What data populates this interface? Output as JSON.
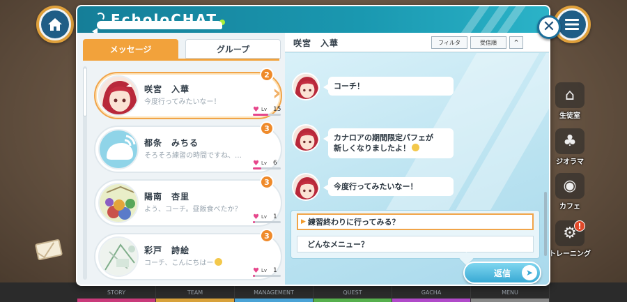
{
  "app": {
    "title": "EcholoCHAT"
  },
  "tabs": [
    {
      "label": "メッセージ",
      "active": true
    },
    {
      "label": "グループ",
      "active": false
    }
  ],
  "contacts": [
    {
      "name": "咲宮　入華",
      "preview": "今度行ってみたいなー！",
      "unread": "2",
      "level": "15",
      "selected": true
    },
    {
      "name": "都条　みちる",
      "preview": "そろそろ練習の時間ですね、…",
      "unread": "3",
      "level": "6",
      "selected": false
    },
    {
      "name": "陽南　杏里",
      "preview": "よう、コーチ。昼飯食べたか？",
      "unread": "3",
      "level": "1",
      "selected": false
    },
    {
      "name": "彩戸　詩絵",
      "preview": "コーチ、こんにちはー",
      "unread": "3",
      "level": "1",
      "selected": false
    }
  ],
  "level_label": "Lv",
  "chat": {
    "partner_name": "咲宮　入華",
    "filter_label": "フィルタ",
    "sort_label": "受信順",
    "messages": [
      {
        "text": "コーチ！"
      },
      {
        "text_line1": "カナロアの期間限定パフェが",
        "text_line2": "新しくなりましたよ！"
      },
      {
        "text": "今度行ってみたいなー！"
      }
    ],
    "choices": [
      {
        "text": "練習終わりに行ってみる？",
        "selected": true
      },
      {
        "text": "どんなメニュー？",
        "selected": false
      }
    ],
    "reply_label": "返信"
  },
  "side_menu": [
    {
      "label": "生徒室",
      "icon": "hanger-icon"
    },
    {
      "label": "ジオラマ",
      "icon": "palm-tree-icon"
    },
    {
      "label": "カフェ",
      "icon": "plate-icon"
    },
    {
      "label": "トレーニング",
      "icon": "bike-icon",
      "badge": "!"
    }
  ],
  "bottom_nav": [
    {
      "label": "STORY",
      "color": "#c93a7a"
    },
    {
      "label": "TEAM",
      "color": "#d8a13a"
    },
    {
      "label": "MANAGEMENT",
      "color": "#4aa3d6"
    },
    {
      "label": "QUEST",
      "color": "#56b04d"
    },
    {
      "label": "GACHA",
      "color": "#b04ac9"
    },
    {
      "label": "MENU",
      "color": "#888888"
    }
  ],
  "colors": {
    "accent": "#f2a23b",
    "titlebar": "#1a98b0",
    "chat_bg": "#bfe5f2"
  }
}
